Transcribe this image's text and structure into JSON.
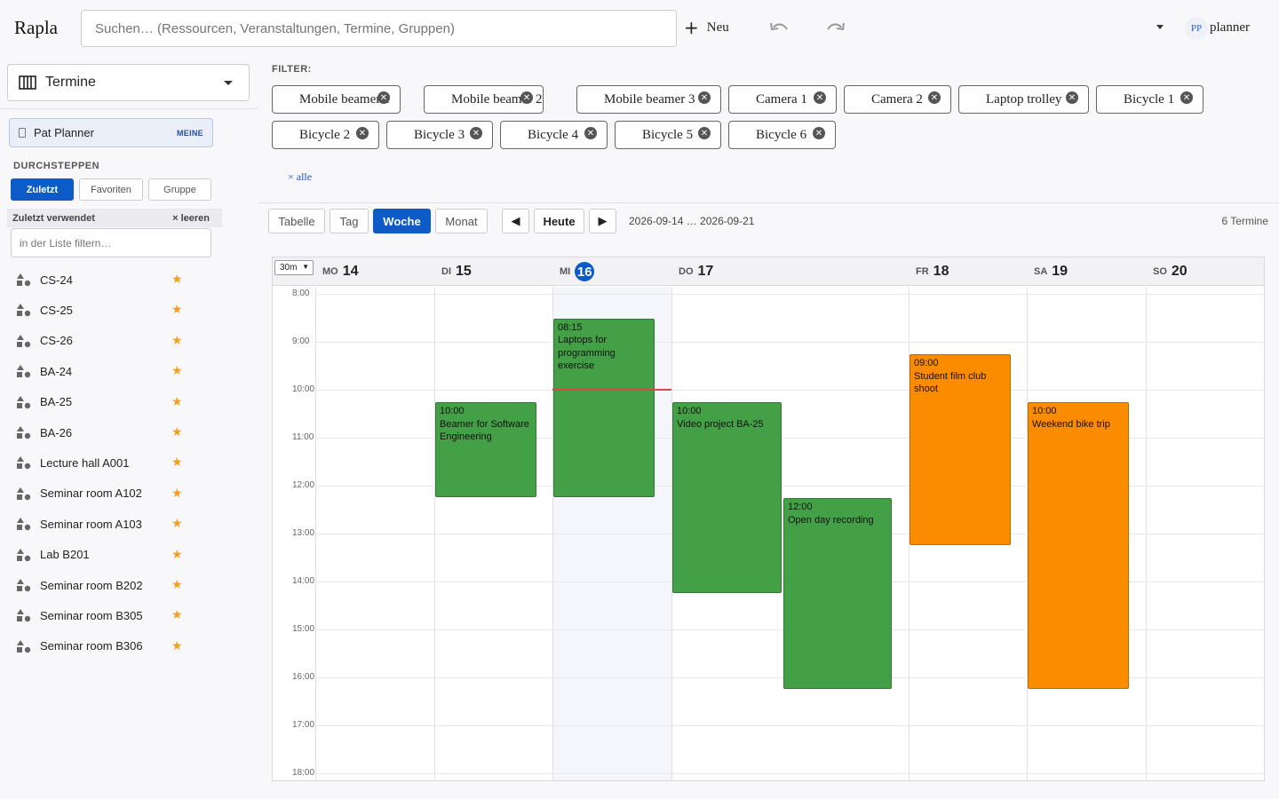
{
  "header": {
    "app_title": "Rapla",
    "search_placeholder": "Suchen… (Ressourcen, Veranstaltungen, Termine, Gruppen)",
    "new_label": "Neu",
    "user_initials": "PP",
    "username": "planner"
  },
  "sidebar": {
    "view_label": "Termine",
    "owner_label": "Pat Planner",
    "owner_badge": "MEINE",
    "section_title": "DURCHSTEPPEN",
    "segments": [
      "Zuletzt",
      "Favoriten",
      "Gruppe"
    ],
    "recent_title": "Zuletzt verwendet",
    "recent_clear": "× leeren",
    "list_filter_placeholder": "in der Liste filtern…",
    "resources": [
      "CS-24",
      "CS-25",
      "CS-26",
      "BA-24",
      "BA-25",
      "BA-26",
      "Lecture hall A001",
      "Seminar room A102",
      "Seminar room A103",
      "Lab B201",
      "Seminar room B202",
      "Seminar room B305",
      "Seminar room B306"
    ]
  },
  "filter": {
    "label": "FILTER:",
    "chips": [
      "Mobile beamer 1",
      "Mobile beamer 2",
      "Mobile beamer 3",
      "Camera 1",
      "Camera 2",
      "Laptop trolley",
      "Bicycle 1",
      "Bicycle 2",
      "Bicycle 3",
      "Bicycle 4",
      "Bicycle 5",
      "Bicycle 6"
    ],
    "all_label": "× alle"
  },
  "toolbar": {
    "views": [
      "Tabelle",
      "Tag",
      "Woche",
      "Monat"
    ],
    "active_view": "Woche",
    "prev": "◀",
    "today": "Heute",
    "next": "▶",
    "date_range": "2026-09-14 … 2026-09-21",
    "count": "6 Termine"
  },
  "calendar": {
    "zoom": "30m",
    "days": [
      {
        "name": "MO",
        "date": "14"
      },
      {
        "name": "DI",
        "date": "15"
      },
      {
        "name": "MI",
        "date": "16"
      },
      {
        "name": "DO",
        "date": "17"
      },
      {
        "name": "FR",
        "date": "18"
      },
      {
        "name": "SA",
        "date": "19"
      },
      {
        "name": "SO",
        "date": "20"
      }
    ],
    "today_index": 2,
    "hours": [
      "8:00",
      "9:00",
      "10:00",
      "11:00",
      "12:00",
      "13:00",
      "14:00",
      "15:00",
      "16:00",
      "17:00",
      "18:00"
    ],
    "colors": {
      "green": "#43a047",
      "orange": "#fb8c00",
      "accent": "#0d5bc6"
    },
    "events": [
      {
        "day": 1,
        "start": 10.0,
        "end": 12.0,
        "time": "10:00",
        "title": "Beamer for Software Engineering",
        "color": "green"
      },
      {
        "day": 2,
        "start": 8.25,
        "end": 12.0,
        "time": "08:15",
        "title": "Laptops for programming exercise",
        "color": "green"
      },
      {
        "day": 3,
        "start": 10.0,
        "end": 14.0,
        "time": "10:00",
        "title": "Video project BA-25",
        "color": "green"
      },
      {
        "day": 3,
        "start": 12.0,
        "end": 16.0,
        "time": "12:00",
        "title": "Open day recording",
        "color": "green",
        "lane": 1
      },
      {
        "day": 4,
        "start": 9.0,
        "end": 13.0,
        "time": "09:00",
        "title": "Student film club shoot",
        "color": "orange"
      },
      {
        "day": 5,
        "start": 10.0,
        "end": 16.0,
        "time": "10:00",
        "title": "Weekend bike trip",
        "color": "orange"
      }
    ],
    "now_hour": 10.0
  }
}
